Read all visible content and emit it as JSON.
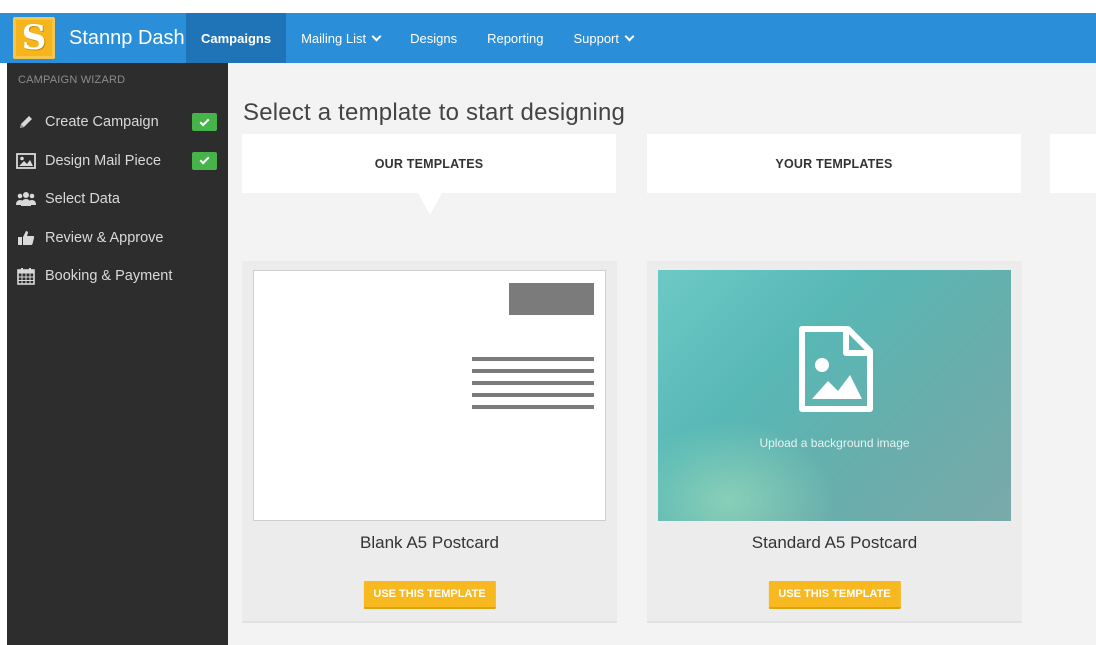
{
  "app": {
    "logo_letter": "S",
    "name": "Stannp Dash",
    "brand_color": "#2a8ed8"
  },
  "nav": {
    "items": [
      {
        "label": "Campaigns",
        "active": true,
        "dropdown": false
      },
      {
        "label": "Mailing List",
        "active": false,
        "dropdown": true
      },
      {
        "label": "Designs",
        "active": false,
        "dropdown": false
      },
      {
        "label": "Reporting",
        "active": false,
        "dropdown": false
      },
      {
        "label": "Support",
        "active": false,
        "dropdown": true
      }
    ]
  },
  "sidebar": {
    "title": "CAMPAIGN WIZARD",
    "items": [
      {
        "label": "Create Campaign",
        "icon": "pencil-icon",
        "completed": true
      },
      {
        "label": "Design Mail Piece",
        "icon": "image-icon",
        "completed": true
      },
      {
        "label": "Select Data",
        "icon": "users-icon",
        "completed": false
      },
      {
        "label": "Review & Approve",
        "icon": "thumbs-up-icon",
        "completed": false
      },
      {
        "label": "Booking & Payment",
        "icon": "calendar-icon",
        "completed": false
      }
    ]
  },
  "main": {
    "title": "Select a template to start designing",
    "tabs": [
      {
        "label": "OUR TEMPLATES",
        "active": true
      },
      {
        "label": "YOUR TEMPLATES",
        "active": false
      }
    ],
    "templates": [
      {
        "name": "Blank A5 Postcard",
        "button": "USE THIS TEMPLATE"
      },
      {
        "name": "Standard A5 Postcard",
        "upload_text": "Upload a background image",
        "button": "USE THIS TEMPLATE"
      }
    ]
  },
  "colors": {
    "sidebar_bg": "#2d2d2d",
    "check_green": "#47b34b",
    "button_yellow": "#f7b91f"
  }
}
